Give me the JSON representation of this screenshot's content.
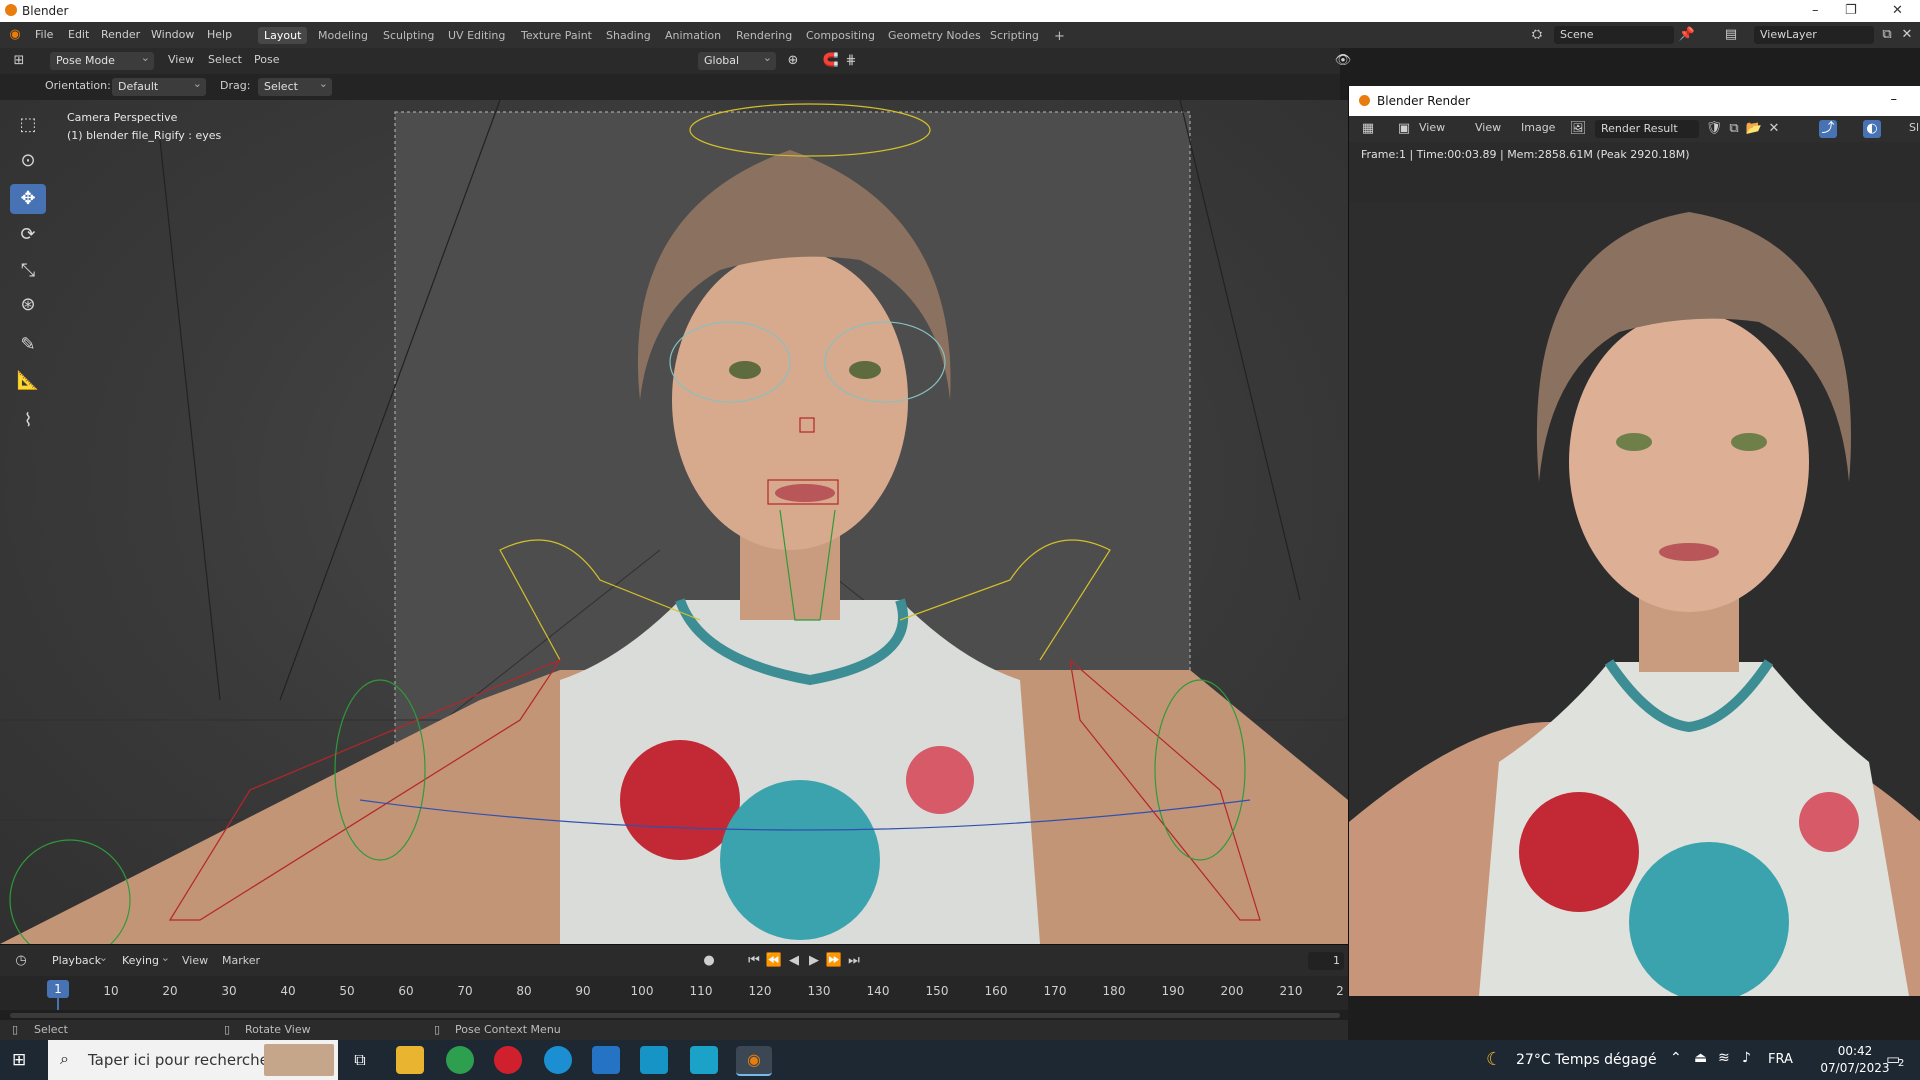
{
  "window": {
    "title": "Blender",
    "minimize": "–",
    "restore": "❐",
    "close": "✕"
  },
  "menu": [
    "File",
    "Edit",
    "Render",
    "Window",
    "Help"
  ],
  "workspaces": [
    "Layout",
    "Modeling",
    "Sculpting",
    "UV Editing",
    "Texture Paint",
    "Shading",
    "Animation",
    "Rendering",
    "Compositing",
    "Geometry Nodes",
    "Scripting"
  ],
  "active_workspace": "Layout",
  "add_workspace": "+",
  "scene": "Scene",
  "view_layer": "ViewLayer",
  "header": {
    "mode": "Pose Mode",
    "view": "View",
    "select": "Select",
    "pose": "Pose",
    "transform_orientation": "Global",
    "orientation_label": "Orientation:",
    "orientation_value": "Default",
    "drag_label": "Drag:",
    "drag_value": "Select Box"
  },
  "viewport": {
    "camera_text": "Camera Perspective",
    "object_text": "(1) blender file_Rigify : eyes"
  },
  "render_window": {
    "title": "Blender Render",
    "view_menu": "View",
    "view": "View",
    "image": "Image",
    "image_name": "Render Result",
    "info": "Frame:1 | Time:00:03.89 | Mem:2858.61M (Peak 2920.18M)",
    "side_hint": "Sl"
  },
  "timeline": {
    "playback": "Playback",
    "keying": "Keying",
    "view": "View",
    "marker": "Marker",
    "current_frame": "1",
    "frame_field": "1",
    "ticks": [
      "10",
      "20",
      "30",
      "40",
      "50",
      "60",
      "70",
      "80",
      "90",
      "100",
      "110",
      "120",
      "130",
      "140",
      "150",
      "160",
      "170",
      "180",
      "190",
      "200",
      "210",
      "2"
    ]
  },
  "statusbar": {
    "select": "Select",
    "rotate": "Rotate View",
    "context": "Pose Context Menu"
  },
  "taskbar": {
    "search_placeholder": "Taper ici pour rechercher",
    "weather": "27°C  Temps dégagé",
    "language": "FRA",
    "time": "00:42",
    "date": "07/07/2023",
    "notification_count": "2"
  },
  "colors": {
    "accent": "#4772b3",
    "blender_orange": "#e87d0d",
    "bone_yellow": "#d4c02a",
    "bone_red": "#b5262a",
    "bone_green": "#2f9a3a"
  }
}
